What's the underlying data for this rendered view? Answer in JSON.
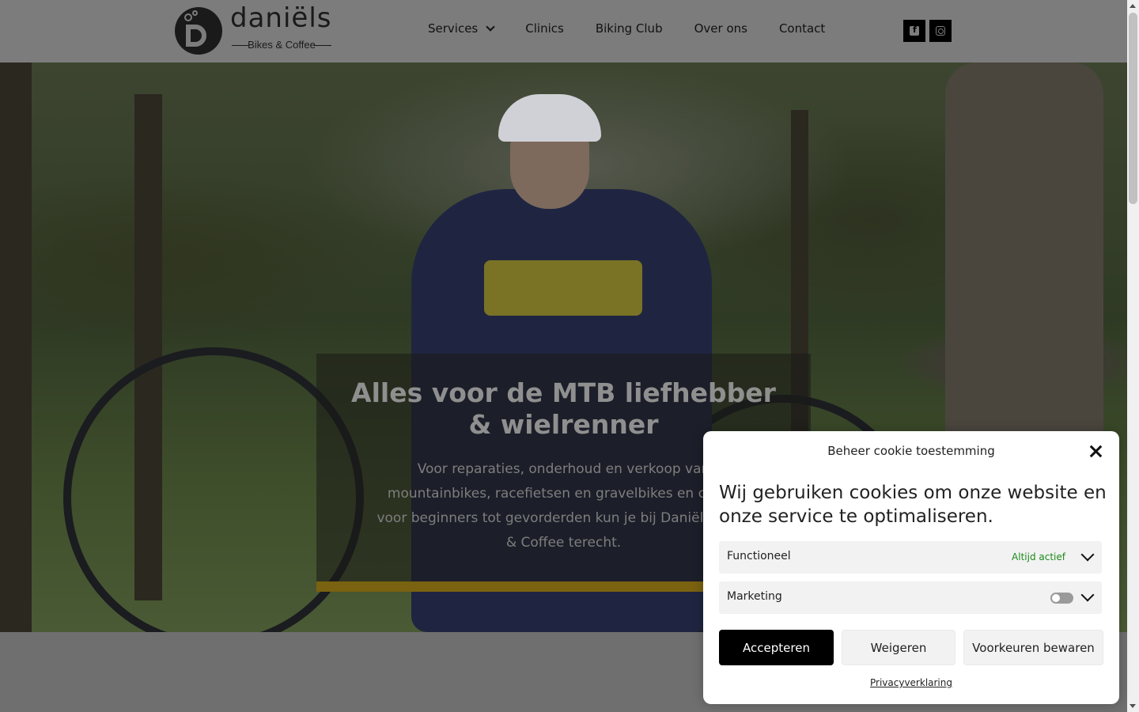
{
  "header": {
    "logo": {
      "name": "daniëls",
      "subtitle": "Bikes & Coffee"
    },
    "nav": [
      {
        "label": "Services",
        "has_dropdown": true
      },
      {
        "label": "Clinics"
      },
      {
        "label": "Biking Club"
      },
      {
        "label": "Over ons"
      },
      {
        "label": "Contact"
      }
    ],
    "social": [
      {
        "icon": "facebook-square-icon"
      },
      {
        "icon": "instagram-icon"
      }
    ]
  },
  "hero": {
    "title": "Alles voor de MTB liefhebber & wielrenner",
    "text": "Voor reparaties, onderhoud en verkoop van mountainbikes, racefietsen en gravelbikes en clinics voor beginners tot gevorderden kun je bij Daniëls Bikes & Coffee terecht.",
    "accent_color": "#7a6210"
  },
  "cookie_dialog": {
    "title": "Beheer cookie toestemming",
    "message": "Wij gebruiken cookies om onze website en onze service te optimaliseren.",
    "categories": [
      {
        "label": "Functioneel",
        "status": "Altijd actief"
      },
      {
        "label": "Marketing",
        "enabled": false
      }
    ],
    "buttons": {
      "accept": "Accepteren",
      "deny": "Weigeren",
      "save": "Voorkeuren bewaren"
    },
    "privacy_link": "Privacyverklaring"
  }
}
